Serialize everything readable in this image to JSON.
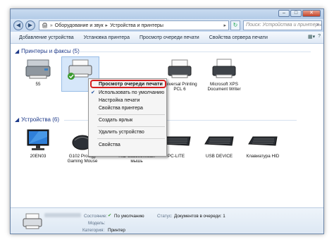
{
  "address": {
    "crumbs": [
      "Оборудование и звук",
      "Устройства и принтеры"
    ],
    "search_placeholder": "Поиск: Устройства и принтеры"
  },
  "toolbar": {
    "items": [
      "Добавление устройства",
      "Установка принтера",
      "Просмотр очереди печати",
      "Свойства сервера печати",
      "Удалить устройство"
    ]
  },
  "printers_group": {
    "label": "Принтеры и факсы (5)"
  },
  "devices_group": {
    "label": "Устройства (6)"
  },
  "printers": [
    {
      "label": "55"
    },
    {
      "label": ""
    },
    {
      "label": "Universal Printing PCL 6"
    },
    {
      "label": "Microsoft XPS Document Writer"
    }
  ],
  "devices": [
    {
      "label": "20EN03"
    },
    {
      "label": "G102 Prodigy Gaming Mouse"
    },
    {
      "label": "HID-совместимая мышь"
    },
    {
      "label": "PC-LITE"
    },
    {
      "label": "USB DEVICE"
    },
    {
      "label": "Клавиатура HID"
    }
  ],
  "context_menu": {
    "items": [
      "Просмотр очереди печати",
      "Использовать по умолчанию",
      "Настройка печати",
      "Свойства принтера",
      "Создать ярлык",
      "Удалить устройство",
      "Свойства"
    ]
  },
  "details": {
    "state_label": "Состояние:",
    "state_value": "По умолчанию",
    "model_label": "Модель:",
    "category_label": "Категория:",
    "category_value": "Принтер",
    "status_label": "Статус:",
    "status_value": "Документов в очереди: 1"
  },
  "colors": {
    "accent": "#1e3a8a",
    "highlight_border": "#d61f1f",
    "selection": "#d6e7fa"
  }
}
